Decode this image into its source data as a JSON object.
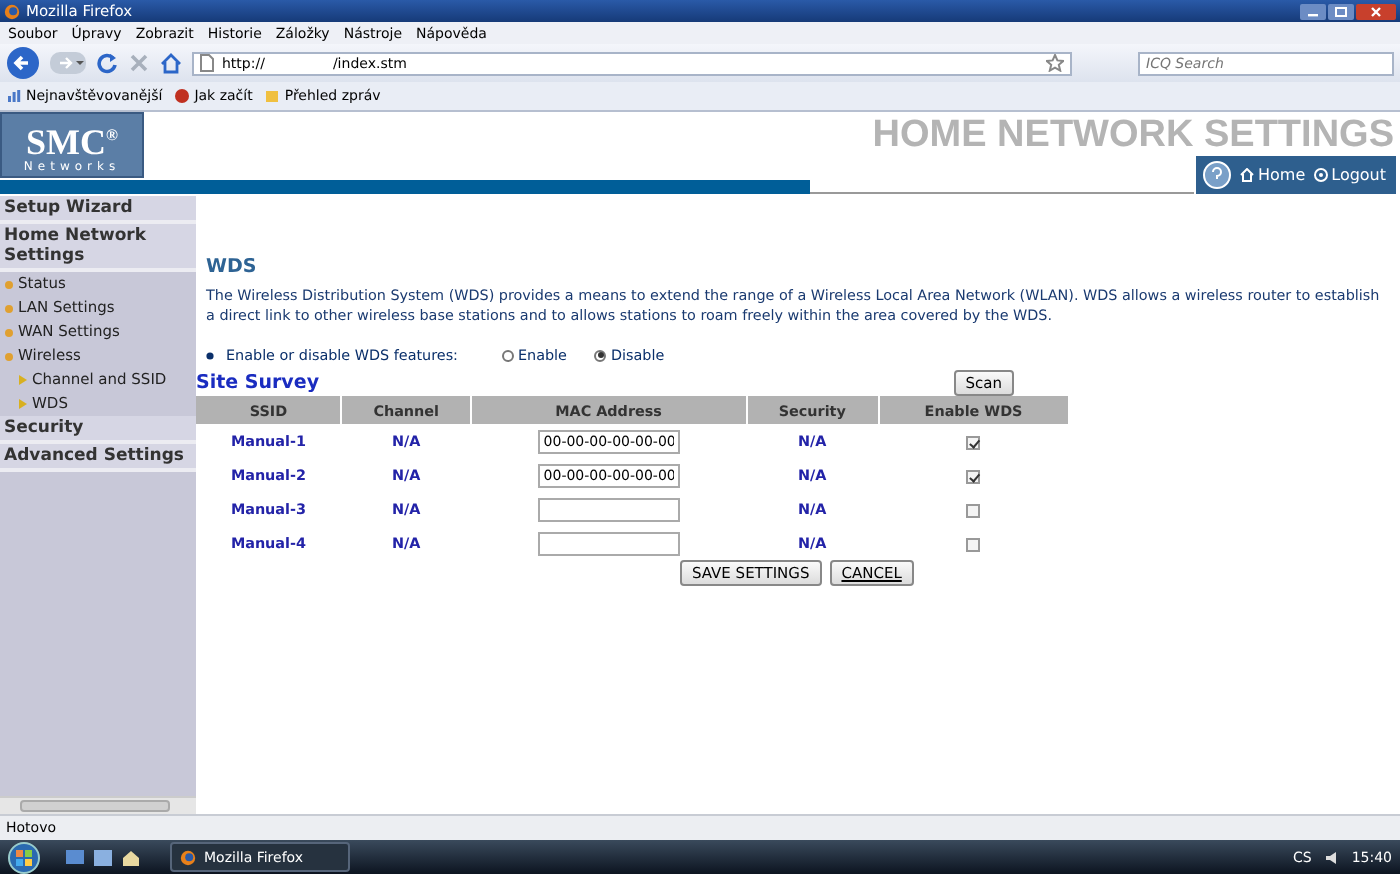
{
  "window": {
    "title": "Mozilla Firefox"
  },
  "menu": [
    "Soubor",
    "Úpravy",
    "Zobrazit",
    "Historie",
    "Záložky",
    "Nástroje",
    "Nápověda"
  ],
  "address_bar": {
    "scheme": "http://",
    "path": "/index.stm"
  },
  "search": {
    "placeholder": "ICQ Search"
  },
  "bookmarks": [
    "Nejnavštěvovanější",
    "Jak začít",
    "Přehled zpráv"
  ],
  "header": {
    "logo": "SMC",
    "logo_mark": "®",
    "logo_sub": "Networks",
    "title": "HOME NETWORK SETTINGS",
    "links": [
      "Home",
      "Logout"
    ]
  },
  "sidebar": {
    "items": [
      {
        "label": "Setup Wizard"
      },
      {
        "label": "Home Network Settings",
        "children": [
          {
            "label": "Status"
          },
          {
            "label": "LAN Settings"
          },
          {
            "label": "WAN Settings"
          },
          {
            "label": "Wireless",
            "children": [
              {
                "label": "Channel and SSID"
              },
              {
                "label": "WDS"
              }
            ]
          }
        ]
      },
      {
        "label": "Security"
      },
      {
        "label": "Advanced Settings"
      }
    ]
  },
  "wds": {
    "title": "WDS",
    "description": "The Wireless Distribution System (WDS) provides a means to extend the range of a Wireless Local Area Network (WLAN). WDS allows a wireless router to establish a direct link to other wireless base stations and to allows stations to roam freely within the area covered by the WDS.",
    "option_label": "Enable or disable WDS features:",
    "options": [
      {
        "label": "Enable",
        "selected": false
      },
      {
        "label": "Disable",
        "selected": true
      }
    ],
    "section": "Site Survey",
    "scan_button": "Scan",
    "columns": [
      "SSID",
      "Channel",
      "MAC Address",
      "Security",
      "Enable WDS"
    ],
    "rows": [
      {
        "ssid": "Manual-1",
        "channel": "N/A",
        "mac": "00-00-00-00-00-00",
        "security": "N/A",
        "checked": true
      },
      {
        "ssid": "Manual-2",
        "channel": "N/A",
        "mac": "00-00-00-00-00-00",
        "security": "N/A",
        "checked": true
      },
      {
        "ssid": "Manual-3",
        "channel": "N/A",
        "security": "N/A",
        "checked": false
      },
      {
        "ssid": "Manual-4",
        "channel": "N/A",
        "security": "N/A",
        "checked": false
      }
    ],
    "buttons": [
      "SAVE SETTINGS",
      "CANCEL"
    ]
  },
  "status_bar": {
    "text": "Hotovo"
  },
  "taskbar": {
    "task": "Mozilla Firefox",
    "language": "CS",
    "time": "15:40"
  }
}
